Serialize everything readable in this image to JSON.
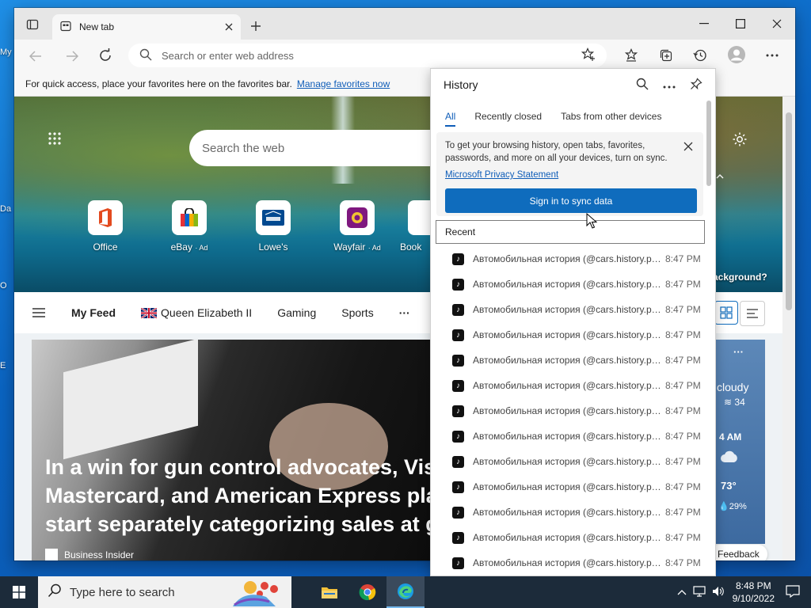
{
  "colors": {
    "accent": "#0f6cbd",
    "link": "#0f5db8",
    "taskbar": "#1c2b3a"
  },
  "desktop": {
    "labels": [
      "My",
      "Da",
      "O",
      "E"
    ]
  },
  "browser": {
    "tab": {
      "title": "New tab",
      "close_icon": "close-icon"
    },
    "new_tab_icon": "plus-icon",
    "window_controls": {
      "minimize": "minimize-icon",
      "maximize": "maximize-icon",
      "close": "close-icon"
    },
    "address": {
      "placeholder": "Search or enter web address"
    },
    "favbar": {
      "message": "For quick access, place your favorites here on the favorites bar.",
      "link": "Manage favorites now"
    }
  },
  "ntp": {
    "search_placeholder": "Search the web",
    "quick_links": [
      {
        "name": "Office",
        "ad": ""
      },
      {
        "name": "eBay",
        "ad": "Ad"
      },
      {
        "name": "Lowe's",
        "ad": ""
      },
      {
        "name": "Wayfair",
        "ad": "Ad"
      },
      {
        "name": "Book",
        "ad": ""
      }
    ],
    "bg_question": "ackground?",
    "feed": {
      "my_feed": "My Feed",
      "items": [
        "Queen Elizabeth II",
        "Gaming",
        "Sports"
      ],
      "more": "···"
    },
    "article": {
      "headline_lines": [
        "In a win for gun control advocates, Vis",
        "Mastercard, and American Express plar",
        "start separately categorizing sales at g"
      ],
      "source": "Business Insider"
    },
    "weather": {
      "cond": "cloudy",
      "aqi": "34",
      "time": "4 AM",
      "temp": "73°",
      "precip": "29%"
    },
    "feedback": "Feedback"
  },
  "history": {
    "title": "History",
    "tabs": [
      "All",
      "Recently closed",
      "Tabs from other devices"
    ],
    "sync_message": "To get your browsing history, open tabs, favorites, passwords, and more on all your devices, turn on sync.",
    "privacy_link": "Microsoft Privacy Statement",
    "sync_button": "Sign in to sync data",
    "recent_label": "Recent",
    "items": [
      {
        "title": "Автомобильная история (@cars.history.ph...",
        "time": "8:47 PM"
      },
      {
        "title": "Автомобильная история (@cars.history.ph...",
        "time": "8:47 PM"
      },
      {
        "title": "Автомобильная история (@cars.history.ph...",
        "time": "8:47 PM"
      },
      {
        "title": "Автомобильная история (@cars.history.ph...",
        "time": "8:47 PM"
      },
      {
        "title": "Автомобильная история (@cars.history.ph...",
        "time": "8:47 PM"
      },
      {
        "title": "Автомобильная история (@cars.history.ph...",
        "time": "8:47 PM"
      },
      {
        "title": "Автомобильная история (@cars.history.ph...",
        "time": "8:47 PM"
      },
      {
        "title": "Автомобильная история (@cars.history.ph...",
        "time": "8:47 PM"
      },
      {
        "title": "Автомобильная история (@cars.history.ph...",
        "time": "8:47 PM"
      },
      {
        "title": "Автомобильная история (@cars.history.ph...",
        "time": "8:47 PM"
      },
      {
        "title": "Автомобильная история (@cars.history.ph...",
        "time": "8:47 PM"
      },
      {
        "title": "Автомобильная история (@cars.history.ph...",
        "time": "8:47 PM"
      },
      {
        "title": "Автомобильная история (@cars.history.ph...",
        "time": "8:47 PM"
      }
    ]
  },
  "taskbar": {
    "search_placeholder": "Type here to search",
    "apps": [
      "file-explorer-icon",
      "chrome-icon",
      "edge-icon"
    ],
    "time": "8:48 PM",
    "date": "9/10/2022"
  }
}
